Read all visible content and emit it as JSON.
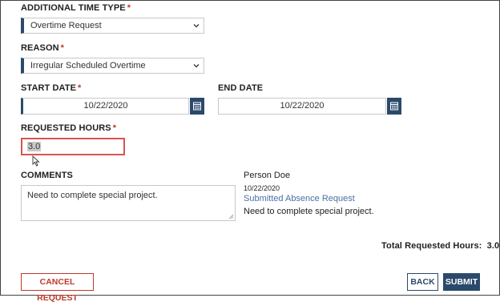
{
  "form": {
    "additional_time_type": {
      "label": "ADDITIONAL TIME TYPE",
      "required_mark": "*",
      "value": "Overtime Request"
    },
    "reason": {
      "label": "REASON",
      "required_mark": "*",
      "value": "Irregular Scheduled Overtime"
    },
    "start_date": {
      "label": "START DATE",
      "required_mark": "*",
      "value": "10/22/2020"
    },
    "end_date": {
      "label": "END DATE",
      "value": "10/22/2020"
    },
    "requested_hours": {
      "label": "REQUESTED HOURS",
      "required_mark": "*",
      "value": "3.0"
    },
    "comments": {
      "label": "COMMENTS",
      "value": "Need to complete special project."
    }
  },
  "history": {
    "person": "Person Doe",
    "date": "10/22/2020",
    "action_link": "Submitted Absence Request",
    "comment": "Need to complete special project."
  },
  "summary": {
    "total_label": "Total Requested Hours:",
    "total_value": "3.0"
  },
  "buttons": {
    "cancel": "CANCEL REQUEST",
    "back": "BACK",
    "submit": "SUBMIT"
  },
  "colors": {
    "accent": "#2b4a6b",
    "required": "#c0392b",
    "error_border": "#d9534f",
    "link": "#4a6fa5"
  },
  "icons": {
    "select_chevron": "chevron-down-icon",
    "calendar": "calendar-icon",
    "cursor": "mouse-cursor-icon",
    "resize": "resize-handle-icon"
  }
}
